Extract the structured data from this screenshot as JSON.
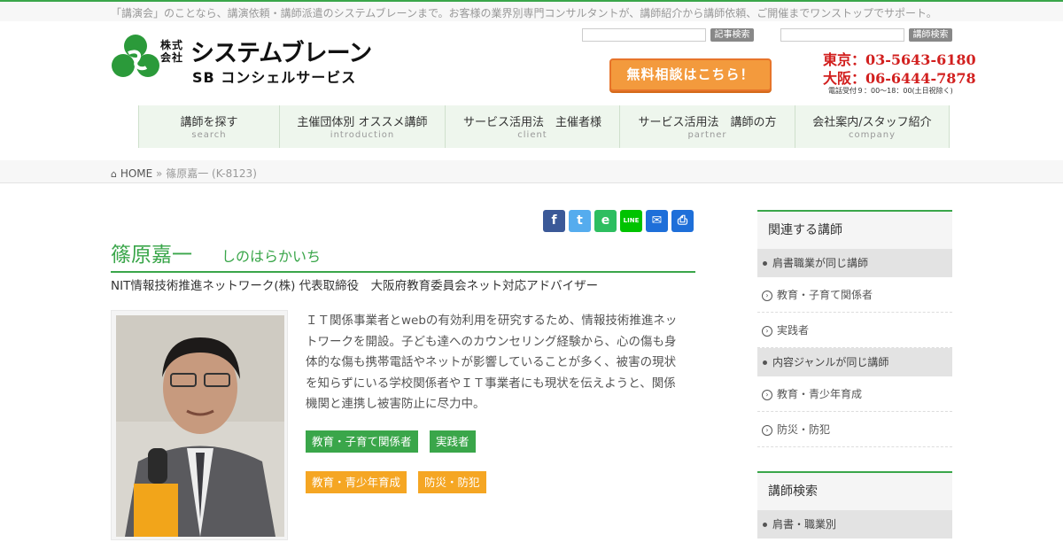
{
  "topbar": {
    "text": "「講演会」のことなら、講演依頼・講師派遣のシステムブレーンまで。お客様の業界別専門コンサルタントが、講師紹介から講師依頼、ご開催までワンストップでサポート。"
  },
  "logo": {
    "kabushiki": "株式",
    "kaisha": "会社",
    "name": "システムブレーン",
    "sub": "SB コンシェルサービス"
  },
  "header": {
    "search_article": {
      "button": "記事検索",
      "value": ""
    },
    "search_lecturer": {
      "button": "講師検索",
      "value": ""
    },
    "cta_label": "無料相談はこちら！",
    "phone_tokyo": "東京：03-5643-6180",
    "phone_osaka": "大阪：06-6444-7878",
    "hours": "電話受付９：00～18：00(土日祝除く)"
  },
  "nav": [
    {
      "jp": "講師を探す",
      "en": "search"
    },
    {
      "jp": "主催団体別 オススメ講師",
      "en": "introduction"
    },
    {
      "jp": "サービス活用法　主催者様",
      "en": "client"
    },
    {
      "jp": "サービス活用法　講師の方",
      "en": "partner"
    },
    {
      "jp": "会社案内/スタッフ紹介",
      "en": "company"
    }
  ],
  "breadcrumb": {
    "home": "HOME",
    "sep": "»",
    "current": "篠原嘉一 (K-8123)"
  },
  "share": {
    "facebook": "f",
    "twitter": "t",
    "evernote": "e",
    "line": "LINE",
    "mail": "✉",
    "print": "⎙",
    "colors": {
      "facebook": "#3b5998",
      "twitter": "#55acee",
      "evernote": "#2dbe60",
      "line": "#00c300",
      "mail": "#1e6fd9",
      "print": "#1e6fd9"
    }
  },
  "profile": {
    "name": "篠原嘉一",
    "kana": "しのはらかいち",
    "title": "NIT情報技術推進ネットワーク(株) 代表取締役　大阪府教育委員会ネット対応アドバイザー",
    "bio": "ＩＴ関係事業者とwebの有効利用を研究するため、情報技術推進ネットワークを開設。子ども達へのカウンセリング経験から、心の傷も身体的な傷も携帯電話やネットが影響していることが多く、被害の現状を知らずにいる学校関係者やＩＴ事業者にも現状を伝えようと、関係機関と連携し被害防止に尽力中。",
    "tags_green": [
      "教育・子育て関係者",
      "実践者"
    ],
    "tags_orange": [
      "教育・青少年育成",
      "防災・防犯"
    ]
  },
  "sidebar": {
    "related_title": "関連する講師",
    "same_role_heading": "肩書職業が同じ講師",
    "same_role_links": [
      "教育・子育て関係者",
      "実践者"
    ],
    "same_genre_heading": "内容ジャンルが同じ講師",
    "same_genre_links": [
      "教育・青少年育成",
      "防災・防犯"
    ],
    "search_title": "講師検索",
    "search_sub": "肩書・職業別"
  },
  "colors": {
    "accent": "#3aa64a",
    "orange": "#f5a623",
    "cta": "#f39a3d",
    "phone": "#d2201f"
  }
}
